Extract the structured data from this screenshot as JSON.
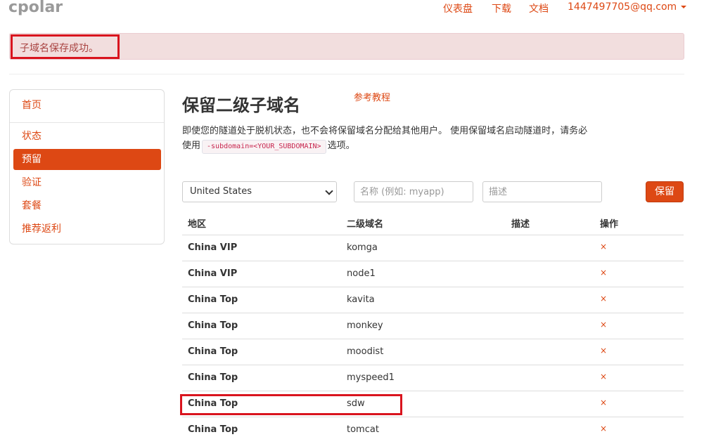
{
  "navbar": {
    "brand": "cpolar",
    "links": [
      "仪表盘",
      "下载",
      "文档"
    ],
    "user": "1447497705@qq.com"
  },
  "alert": {
    "text": "子域名保存成功。"
  },
  "sidebar": {
    "items": [
      {
        "label": "首页"
      },
      {
        "label": "状态"
      },
      {
        "label": "预留"
      },
      {
        "label": "验证"
      },
      {
        "label": "套餐"
      },
      {
        "label": "推荐返利"
      }
    ]
  },
  "main": {
    "title": "保留二级子域名",
    "tutorial": "参考教程",
    "desc_before": "即使您的隧道处于脱机状态，也不会将保留域名分配给其他用户。 使用保留域名启动隧道时，请务必使用",
    "desc_code": "-subdomain=<YOUR_SUBDOMAIN>",
    "desc_after": "选项。"
  },
  "form": {
    "region_selected": "United States",
    "name_placeholder": "名称 (例如: myapp)",
    "desc_placeholder": "描述",
    "save_label": "保留"
  },
  "table": {
    "headers": [
      "地区",
      "二级域名",
      "描述",
      "操作"
    ],
    "rows": [
      {
        "region": "China VIP",
        "subdomain": "komga",
        "desc": "",
        "action": "×"
      },
      {
        "region": "China VIP",
        "subdomain": "node1",
        "desc": "",
        "action": "×"
      },
      {
        "region": "China Top",
        "subdomain": "kavita",
        "desc": "",
        "action": "×"
      },
      {
        "region": "China Top",
        "subdomain": "monkey",
        "desc": "",
        "action": "×"
      },
      {
        "region": "China Top",
        "subdomain": "moodist",
        "desc": "",
        "action": "×"
      },
      {
        "region": "China Top",
        "subdomain": "myspeed1",
        "desc": "",
        "action": "×"
      },
      {
        "region": "China Top",
        "subdomain": "sdw",
        "desc": "",
        "action": "×"
      },
      {
        "region": "China Top",
        "subdomain": "tomcat",
        "desc": "",
        "action": "×"
      }
    ]
  },
  "colors": {
    "accent": "#dd4814",
    "alert_bg": "#f2dede",
    "alert_text": "#a94442",
    "highlight": "#d9141e"
  },
  "icons": {
    "dropdown": "caret-down-icon",
    "delete": "close-icon"
  }
}
